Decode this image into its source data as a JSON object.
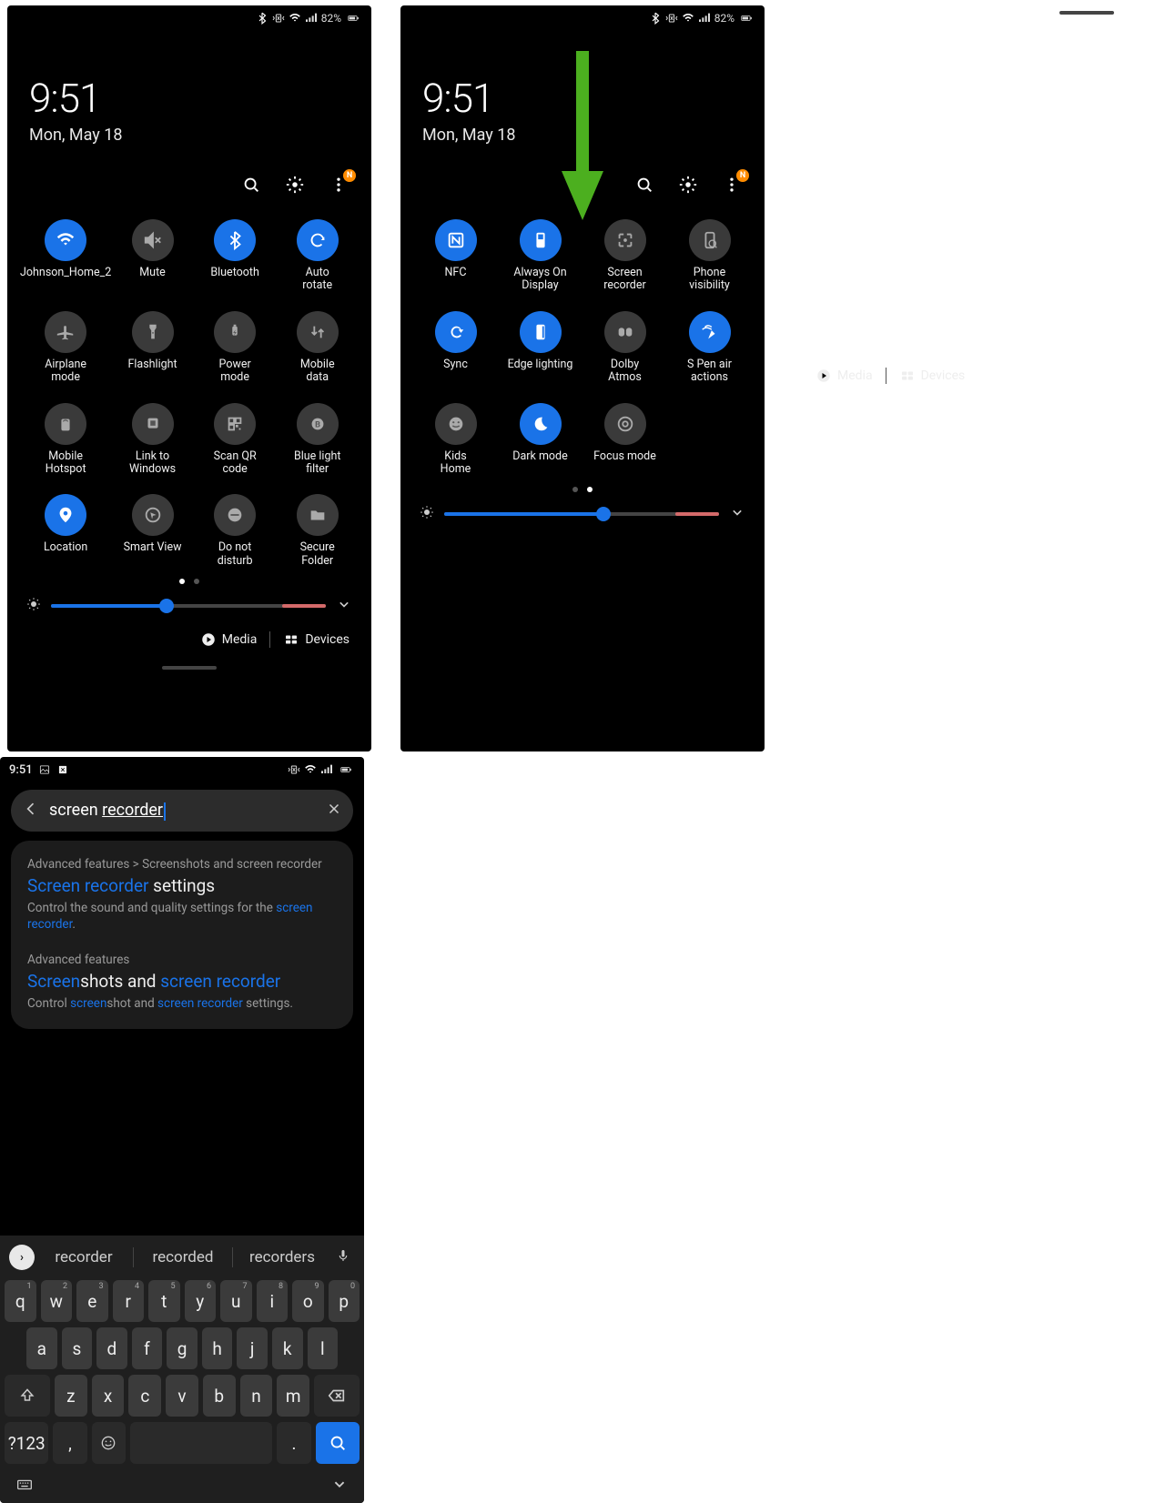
{
  "status": {
    "time": "9:51",
    "battery": "82%"
  },
  "panel": {
    "time": "9:51",
    "date": "Mon, May 18",
    "more_badge": "N",
    "media_label": "Media",
    "devices_label": "Devices"
  },
  "panel1_tiles": [
    {
      "label": "Johnson_Home_2",
      "on": true,
      "icon": "wifi"
    },
    {
      "label": "Mute",
      "on": false,
      "icon": "mute"
    },
    {
      "label": "Bluetooth",
      "on": true,
      "icon": "bluetooth"
    },
    {
      "label": "Auto\nrotate",
      "on": true,
      "icon": "rotate"
    },
    {
      "label": "Airplane\nmode",
      "on": false,
      "icon": "airplane"
    },
    {
      "label": "Flashlight",
      "on": false,
      "icon": "flashlight"
    },
    {
      "label": "Power\nmode",
      "on": false,
      "icon": "power"
    },
    {
      "label": "Mobile\ndata",
      "on": false,
      "icon": "mobiledata"
    },
    {
      "label": "Mobile\nHotspot",
      "on": false,
      "icon": "hotspot"
    },
    {
      "label": "Link to\nWindows",
      "on": false,
      "icon": "link"
    },
    {
      "label": "Scan QR\ncode",
      "on": false,
      "icon": "qr"
    },
    {
      "label": "Blue light\nfilter",
      "on": false,
      "icon": "bluelight"
    },
    {
      "label": "Location",
      "on": true,
      "icon": "location"
    },
    {
      "label": "Smart View",
      "on": false,
      "icon": "smartview"
    },
    {
      "label": "Do not\ndisturb",
      "on": false,
      "icon": "dnd"
    },
    {
      "label": "Secure\nFolder",
      "on": false,
      "icon": "folder"
    }
  ],
  "panel1_slider_pct": 42,
  "panel2_tiles": [
    {
      "label": "NFC",
      "on": true,
      "icon": "nfc"
    },
    {
      "label": "Always On\nDisplay",
      "on": true,
      "icon": "aod"
    },
    {
      "label": "Screen\nrecorder",
      "on": false,
      "icon": "screenrec"
    },
    {
      "label": "Phone\nvisibility",
      "on": false,
      "icon": "visibility"
    },
    {
      "label": "Sync",
      "on": true,
      "icon": "sync"
    },
    {
      "label": "Edge lighting",
      "on": true,
      "icon": "edge"
    },
    {
      "label": "Dolby\nAtmos",
      "on": false,
      "icon": "dolby"
    },
    {
      "label": "S Pen air\nactions",
      "on": true,
      "icon": "spen"
    },
    {
      "label": "Kids\nHome",
      "on": false,
      "icon": "kids"
    },
    {
      "label": "Dark mode",
      "on": true,
      "icon": "darkmode"
    },
    {
      "label": "Focus mode",
      "on": false,
      "icon": "focus"
    }
  ],
  "panel2_slider_pct": 58,
  "search": {
    "query": "screen recorder",
    "suggestions": [
      "recorder",
      "recorded",
      "recorders"
    ],
    "results": [
      {
        "crumb": "Advanced features > Screenshots and screen recorder",
        "title_pre_hl": "Screen recorder",
        "title_rest": " settings",
        "desc_pre": "Control the sound and quality settings for the ",
        "desc_hl": "screen recorder",
        "desc_post": "."
      },
      {
        "crumb": "Advanced features",
        "title_parts": [
          {
            "t": "Screen",
            "hl": true
          },
          {
            "t": "shots and ",
            "hl": false
          },
          {
            "t": "screen recorder",
            "hl": true
          }
        ],
        "desc_parts": [
          {
            "t": "Control ",
            "hl": false
          },
          {
            "t": "screen",
            "hl": true
          },
          {
            "t": "shot and ",
            "hl": false
          },
          {
            "t": "screen recorder",
            "hl": true
          },
          {
            "t": " settings.",
            "hl": false
          }
        ]
      }
    ]
  },
  "keyboard": {
    "row1": [
      {
        "c": "q",
        "n": "1"
      },
      {
        "c": "w",
        "n": "2"
      },
      {
        "c": "e",
        "n": "3"
      },
      {
        "c": "r",
        "n": "4"
      },
      {
        "c": "t",
        "n": "5"
      },
      {
        "c": "y",
        "n": "6"
      },
      {
        "c": "u",
        "n": "7"
      },
      {
        "c": "i",
        "n": "8"
      },
      {
        "c": "o",
        "n": "9"
      },
      {
        "c": "p",
        "n": "0"
      }
    ],
    "row2": [
      "a",
      "s",
      "d",
      "f",
      "g",
      "h",
      "j",
      "k",
      "l"
    ],
    "row3": [
      "z",
      "x",
      "c",
      "v",
      "b",
      "n",
      "m"
    ],
    "sym": "?123",
    "comma": ",",
    "period": "."
  }
}
